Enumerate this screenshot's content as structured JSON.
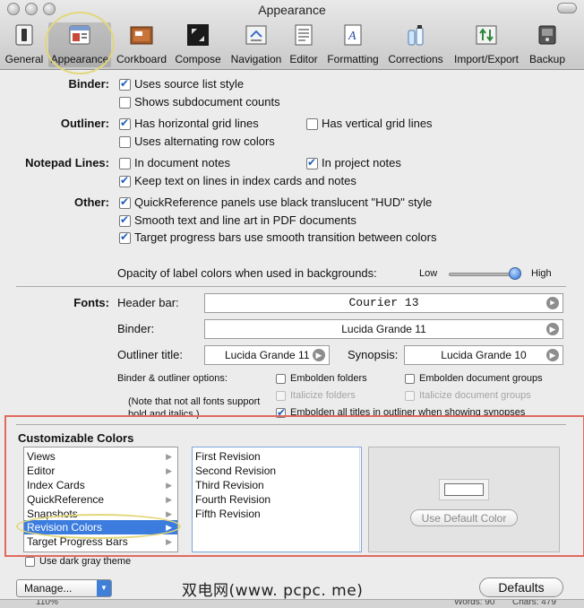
{
  "window": {
    "title": "Appearance"
  },
  "toolbar": {
    "items": [
      {
        "label": "General",
        "icon": "general-switch-icon"
      },
      {
        "label": "Appearance",
        "icon": "appearance-window-icon"
      },
      {
        "label": "Corkboard",
        "icon": "corkboard-icon"
      },
      {
        "label": "Compose",
        "icon": "compose-fullscreen-icon"
      },
      {
        "label": "Navigation",
        "icon": "navigation-icon"
      },
      {
        "label": "Editor",
        "icon": "editor-icon"
      },
      {
        "label": "Formatting",
        "icon": "formatting-icon"
      },
      {
        "label": "Corrections",
        "icon": "corrections-bottles-icon"
      },
      {
        "label": "Import/Export",
        "icon": "import-export-icon"
      },
      {
        "label": "Backup",
        "icon": "backup-drive-icon"
      }
    ]
  },
  "binder": {
    "label": "Binder:",
    "opt1": {
      "text": "Uses source list style",
      "checked": true
    },
    "opt2": {
      "text": "Shows subdocument counts",
      "checked": false
    }
  },
  "outliner": {
    "label": "Outliner:",
    "opt1": {
      "text": "Has horizontal grid lines",
      "checked": true
    },
    "opt2": {
      "text": "Has vertical grid lines",
      "checked": false
    },
    "opt3": {
      "text": "Uses alternating row colors",
      "checked": false
    }
  },
  "notepad": {
    "label": "Notepad Lines:",
    "opt1": {
      "text": "In document notes",
      "checked": false
    },
    "opt2": {
      "text": "In project notes",
      "checked": true
    },
    "opt3": {
      "text": "Keep text on lines in index cards and notes",
      "checked": true
    }
  },
  "other": {
    "label": "Other:",
    "opt1": {
      "text": "QuickReference panels use black translucent \"HUD\" style",
      "checked": true
    },
    "opt2": {
      "text": "Smooth text and line art in PDF documents",
      "checked": true
    },
    "opt3": {
      "text": "Target progress bars use smooth transition between colors",
      "checked": true
    }
  },
  "opacity": {
    "label": "Opacity of label colors when used in backgrounds:",
    "low": "Low",
    "high": "High",
    "value": 1.0
  },
  "fonts": {
    "label": "Fonts:",
    "header_bar_label": "Header bar:",
    "header_bar_value": "Courier 13",
    "binder_label": "Binder:",
    "binder_value": "Lucida Grande 11",
    "outliner_title_label": "Outliner title:",
    "outliner_title_value": "Lucida Grande 11",
    "synopsis_label": "Synopsis:",
    "synopsis_value": "Lucida Grande 10"
  },
  "binder_outliner": {
    "label": "Binder & outliner options:",
    "note": "(Note that not all fonts support bold and italics.)",
    "embolden_folders": {
      "text": "Embolden folders",
      "checked": false
    },
    "embolden_doc_groups": {
      "text": "Embolden document groups",
      "checked": false
    },
    "italicize_folders": {
      "text": "Italicize folders",
      "checked": false
    },
    "italicize_doc_groups": {
      "text": "Italicize document groups",
      "checked": false
    },
    "embolden_titles": {
      "text": "Embolden all titles in outliner when showing synopses",
      "checked": true
    }
  },
  "colors": {
    "title": "Customizable Colors",
    "categories": [
      "Views",
      "Editor",
      "Index Cards",
      "QuickReference",
      "Snapshots",
      "Revision Colors",
      "Target Progress Bars"
    ],
    "selected_category": "Revision Colors",
    "items": [
      "First Revision",
      "Second Revision",
      "Third Revision",
      "Fourth Revision",
      "Fifth Revision"
    ],
    "use_default_label": "Use Default Color",
    "dark_gray": {
      "text": "Use dark gray theme",
      "checked": false
    }
  },
  "bottom": {
    "manage_label": "Manage...",
    "defaults_label": "Defaults",
    "watermark": "双电网(www. pcpc. me)"
  },
  "status": {
    "zoom": "110%",
    "words": "Words: 90",
    "chars": "Chars: 479"
  },
  "accent_colors": {
    "selection": "#3c7cde",
    "highlight_circle": "#e3d77a",
    "highlight_rect": "#e06a5e"
  }
}
